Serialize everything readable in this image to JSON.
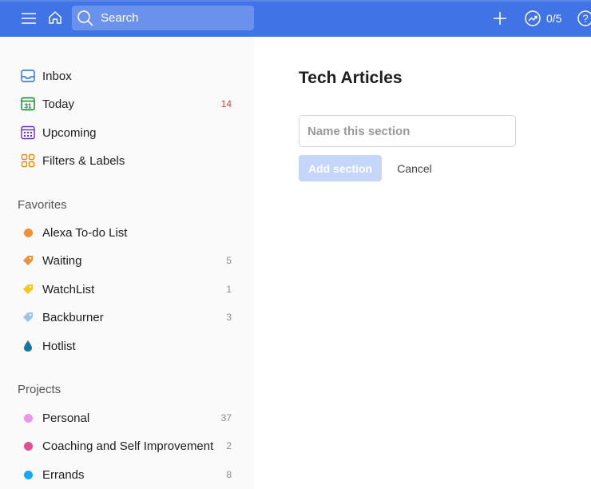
{
  "topbar": {
    "search_placeholder": "Search",
    "karma_text": "0/5"
  },
  "nav": {
    "inbox": "Inbox",
    "today": "Today",
    "today_count": "14",
    "today_icon_day": "31",
    "upcoming": "Upcoming",
    "filters": "Filters & Labels"
  },
  "favorites": {
    "header": "Favorites",
    "items": [
      {
        "label": "Alexa To-do List",
        "count": "",
        "color": "#f0903a"
      },
      {
        "label": "Waiting",
        "count": "5",
        "color": "#f0903a"
      },
      {
        "label": "WatchList",
        "count": "1",
        "color": "#f5c518"
      },
      {
        "label": "Backburner",
        "count": "3",
        "color": "#9cc4ec"
      },
      {
        "label": "Hotlist",
        "count": "",
        "color": "#14789c"
      }
    ]
  },
  "projects": {
    "header": "Projects",
    "items": [
      {
        "label": "Personal",
        "count": "37",
        "color": "#eb96eb"
      },
      {
        "label": "Coaching and Self Improvement",
        "count": "2",
        "color": "#e05194"
      },
      {
        "label": "Errands",
        "count": "8",
        "color": "#14aaf5"
      }
    ]
  },
  "main": {
    "title": "Tech Articles",
    "section_placeholder": "Name this section",
    "add_label": "Add section",
    "cancel_label": "Cancel"
  }
}
